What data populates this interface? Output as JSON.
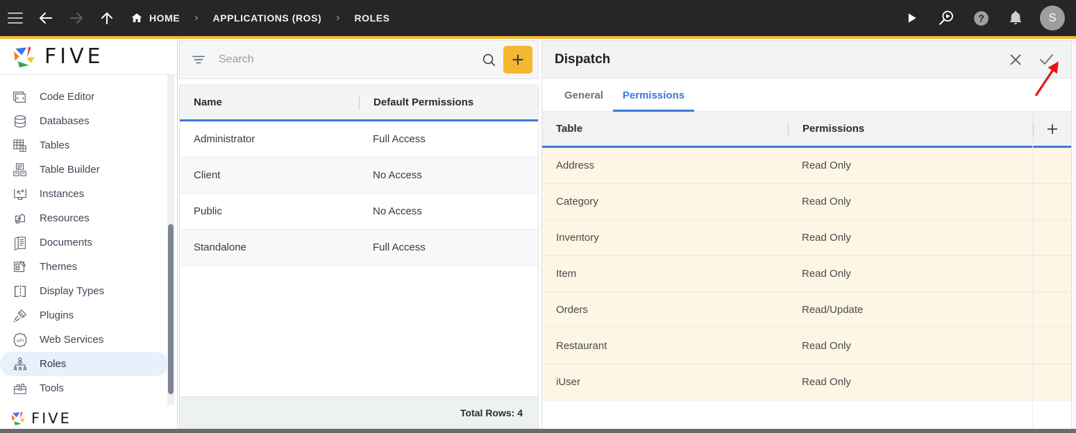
{
  "topbar": {
    "menu_icon": "hamburger-icon",
    "back_icon": "arrow-left-icon",
    "forward_icon": "arrow-right-icon",
    "up_icon": "arrow-up-icon",
    "breadcrumbs": [
      {
        "label": "HOME",
        "icon": "home-icon"
      },
      {
        "label": "APPLICATIONS (ROS)",
        "icon": ""
      },
      {
        "label": "ROLES",
        "icon": ""
      }
    ],
    "separator": "›",
    "actions": [
      {
        "name": "run-button",
        "icon": "play-icon"
      },
      {
        "name": "debug-button",
        "icon": "magnifier-play-icon"
      },
      {
        "name": "help-button",
        "icon": "help-circle-icon"
      },
      {
        "name": "notifications-button",
        "icon": "bell-icon"
      }
    ],
    "avatar_initial": "S",
    "accent_color": "#F4B731"
  },
  "sidebar": {
    "logo_text": "FIVE",
    "footer_logo_text": "FIVE",
    "items": [
      {
        "label": "Code Editor",
        "icon": "code-editor-icon",
        "active": false
      },
      {
        "label": "Databases",
        "icon": "database-icon",
        "active": false
      },
      {
        "label": "Tables",
        "icon": "table-icon",
        "active": false
      },
      {
        "label": "Table Builder",
        "icon": "table-builder-icon",
        "active": false
      },
      {
        "label": "Instances",
        "icon": "instances-icon",
        "active": false
      },
      {
        "label": "Resources",
        "icon": "resources-icon",
        "active": false
      },
      {
        "label": "Documents",
        "icon": "documents-icon",
        "active": false
      },
      {
        "label": "Themes",
        "icon": "themes-icon",
        "active": false
      },
      {
        "label": "Display Types",
        "icon": "display-types-icon",
        "active": false
      },
      {
        "label": "Plugins",
        "icon": "plugins-icon",
        "active": false
      },
      {
        "label": "Web Services",
        "icon": "api-icon",
        "active": false
      },
      {
        "label": "Roles",
        "icon": "roles-icon",
        "active": true
      },
      {
        "label": "Tools",
        "icon": "tools-icon",
        "active": false
      }
    ]
  },
  "list_panel": {
    "filter_icon": "filter-icon",
    "search": {
      "value": "",
      "placeholder": "Search"
    },
    "search_icon": "search-icon",
    "add_label": "+",
    "columns": [
      "Name",
      "Default Permissions"
    ],
    "rows": [
      {
        "name": "Administrator",
        "permissions": "Full Access"
      },
      {
        "name": "Client",
        "permissions": "No Access"
      },
      {
        "name": "Public",
        "permissions": "No Access"
      },
      {
        "name": "Standalone",
        "permissions": "Full Access"
      }
    ],
    "footer_total": "Total Rows: 4"
  },
  "detail_panel": {
    "title": "Dispatch",
    "close_icon": "close-icon",
    "confirm_icon": "check-icon",
    "tabs": [
      {
        "label": "General",
        "active": false
      },
      {
        "label": "Permissions",
        "active": true
      }
    ],
    "columns": [
      "Table",
      "Permissions"
    ],
    "add_icon": "plus-icon",
    "rows": [
      {
        "table": "Address",
        "permissions": "Read Only"
      },
      {
        "table": "Category",
        "permissions": "Read Only"
      },
      {
        "table": "Inventory",
        "permissions": "Read Only"
      },
      {
        "table": "Item",
        "permissions": "Read Only"
      },
      {
        "table": "Orders",
        "permissions": "Read/Update"
      },
      {
        "table": "Restaurant",
        "permissions": "Read Only"
      },
      {
        "table": "iUser",
        "permissions": "Read Only"
      }
    ]
  },
  "annotation": {
    "type": "red-arrow",
    "color": "#E81414",
    "points_to": "check-icon"
  },
  "colors": {
    "accent": "#F4B731",
    "header_underline": "#3C78D8",
    "active_tab": "#3C78D8",
    "row_highlight": "#FDF6E4",
    "topbar_bg": "#262626"
  }
}
